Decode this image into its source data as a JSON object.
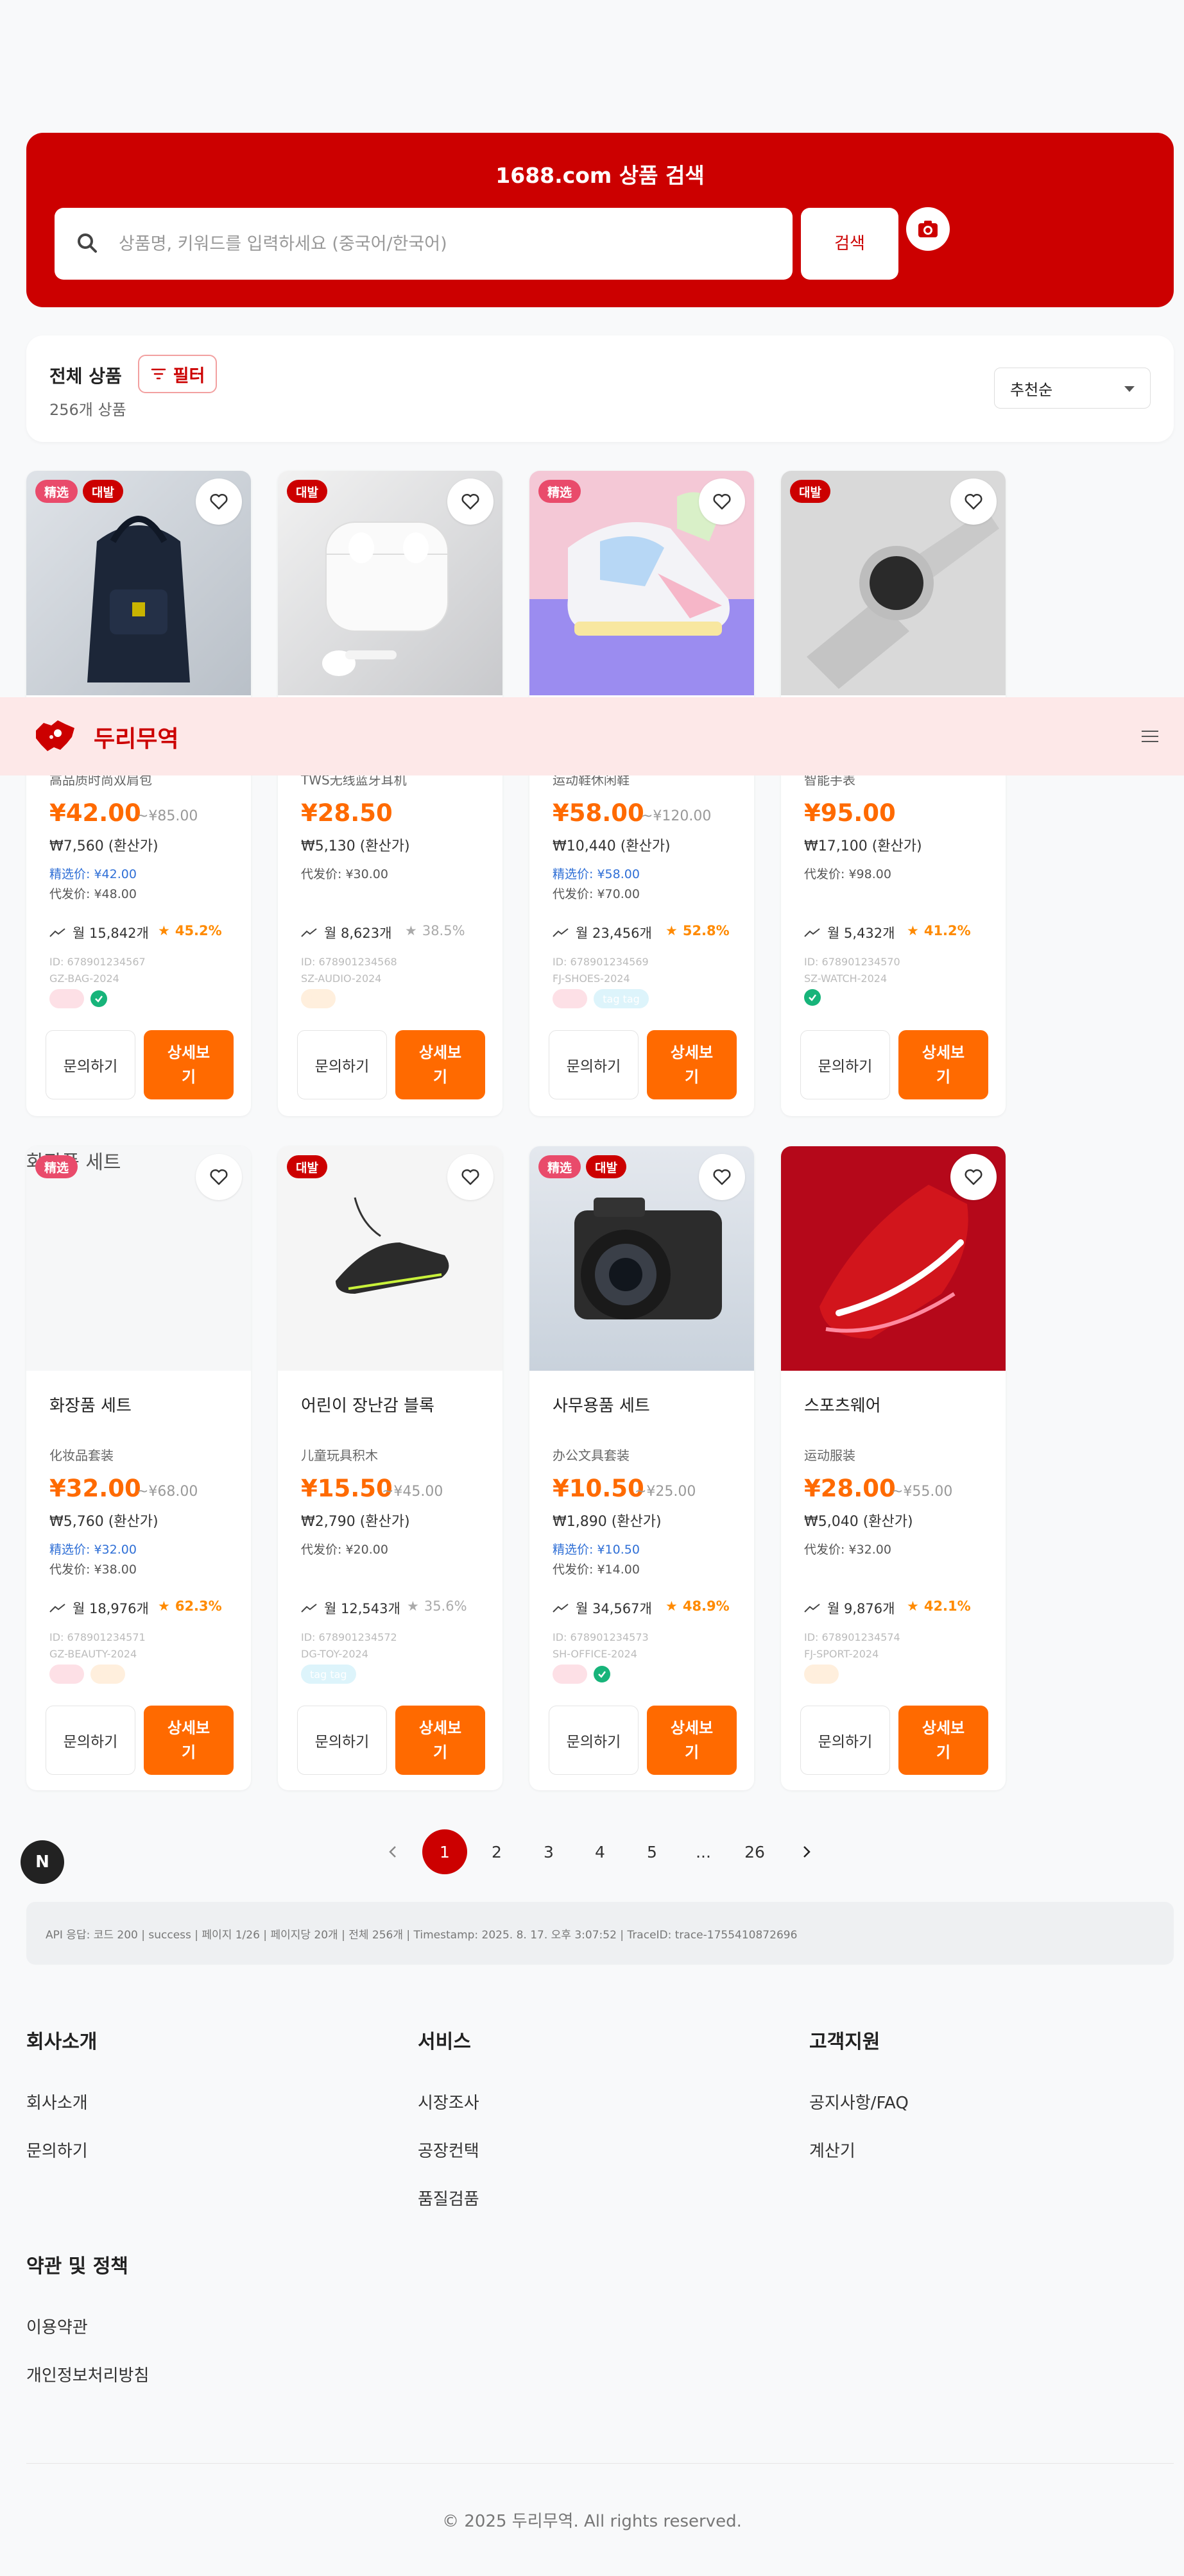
{
  "search": {
    "title": "1688.com 상품 검색",
    "placeholder": "상품명, 키워드를 입력하세요 (중국어/한국어)",
    "button_label": "검색"
  },
  "listing": {
    "heading": "전체 상품",
    "count": "256개 상품",
    "filter_label": "필터",
    "sort_value": "추천순"
  },
  "header": {
    "brand": "두리무역"
  },
  "colors": {
    "brand_red": "#cc0000",
    "price_orange": "#ff6a00",
    "badge_pink": "#e94b6b"
  },
  "products": [
    {
      "badges": [
        "精选",
        "대발"
      ],
      "cname": "高品质时尚双肩包",
      "price": "¥42.00",
      "oprice": "~¥85.00",
      "krw": "₩7,560 (환산가)",
      "jx": "精选价: ¥42.00",
      "dg": "代发价: ¥48.00",
      "sales": "월 15,842개",
      "rate": "45.2%",
      "id1": "ID: 678901234567",
      "id2": "GZ-BAG-2024"
    },
    {
      "badges": [
        "대발"
      ],
      "cname": "TWS无线蓝牙耳机",
      "price": "¥28.50",
      "oprice": "",
      "krw": "₩5,130 (환산가)",
      "jx": "",
      "dg": "代发价: ¥30.00",
      "sales": "월 8,623개",
      "rate": "38.5%",
      "id1": "ID: 678901234568",
      "id2": "SZ-AUDIO-2024"
    },
    {
      "badges": [
        "精选"
      ],
      "cname": "运动鞋休闲鞋",
      "price": "¥58.00",
      "oprice": "~¥120.00",
      "krw": "₩10,440 (환산가)",
      "jx": "精选价: ¥58.00",
      "dg": "代发价: ¥70.00",
      "sales": "월 23,456개",
      "rate": "52.8%",
      "id1": "ID: 678901234569",
      "id2": "FJ-SHOES-2024"
    },
    {
      "badges": [
        "대발"
      ],
      "cname": "智能手表",
      "price": "¥95.00",
      "oprice": "",
      "krw": "₩17,100 (환산가)",
      "jx": "",
      "dg": "代发价: ¥98.00",
      "sales": "월 5,432개",
      "rate": "41.2%",
      "id1": "ID: 678901234570",
      "id2": "SZ-WATCH-2024"
    },
    {
      "badges": [
        "精选"
      ],
      "img_alt": "화장품 세트",
      "name": "화장품 세트",
      "cname": "化妆品套装",
      "price": "¥32.00",
      "oprice": "~¥68.00",
      "krw": "₩5,760 (환산가)",
      "jx": "精选价: ¥32.00",
      "dg": "代发价: ¥38.00",
      "sales": "월 18,976개",
      "rate": "62.3%",
      "id1": "ID: 678901234571",
      "id2": "GZ-BEAUTY-2024"
    },
    {
      "badges": [
        "대발"
      ],
      "name": "어린이 장난감 블록",
      "cname": "儿童玩具积木",
      "price": "¥15.50",
      "oprice": "~¥45.00",
      "krw": "₩2,790 (환산가)",
      "jx": "",
      "dg": "代发价: ¥20.00",
      "sales": "월 12,543개",
      "rate": "35.6%",
      "id1": "ID: 678901234572",
      "id2": "DG-TOY-2024"
    },
    {
      "badges": [
        "精选",
        "대발"
      ],
      "name": "사무용품 세트",
      "cname": "办公文具套装",
      "price": "¥10.50",
      "oprice": "~¥25.00",
      "krw": "₩1,890 (환산가)",
      "jx": "精选价: ¥10.50",
      "dg": "代发价: ¥14.00",
      "sales": "월 34,567개",
      "rate": "48.9%",
      "id1": "ID: 678901234573",
      "id2": "SH-OFFICE-2024"
    },
    {
      "badges": [],
      "name": "스포츠웨어",
      "cname": "运动服装",
      "price": "¥28.00",
      "oprice": "~¥55.00",
      "krw": "₩5,040 (환산가)",
      "jx": "",
      "dg": "代发价: ¥32.00",
      "sales": "월 9,876개",
      "rate": "42.1%",
      "id1": "ID: 678901234574",
      "id2": "FJ-SPORT-2024"
    }
  ],
  "card_buttons": {
    "inquiry": "문의하기",
    "detail": "상세보기"
  },
  "pagination": {
    "pages": [
      "1",
      "2",
      "3",
      "4",
      "5",
      "...",
      "26"
    ],
    "nav_float": "N"
  },
  "api_status": "API 응답: 코드 200 | success | 페이지 1/26 | 페이지당 20개 | 전체 256개 | Timestamp: 2025. 8. 17. 오후 3:07:52 | TraceID: trace-1755410872696",
  "footer": {
    "company": {
      "title": "회사소개",
      "links": [
        "회사소개",
        "문의하기"
      ]
    },
    "services": {
      "title": "서비스",
      "links": [
        "시장조사",
        "공장컨택",
        "품질검품"
      ]
    },
    "support": {
      "title": "고객지원",
      "links": [
        "공지사항/FAQ",
        "계산기"
      ]
    },
    "policy": {
      "title": "약관 및 정책",
      "links": [
        "이용약관",
        "개인정보처리방침"
      ]
    },
    "copyright": "© 2025 두리무역. All rights reserved."
  }
}
